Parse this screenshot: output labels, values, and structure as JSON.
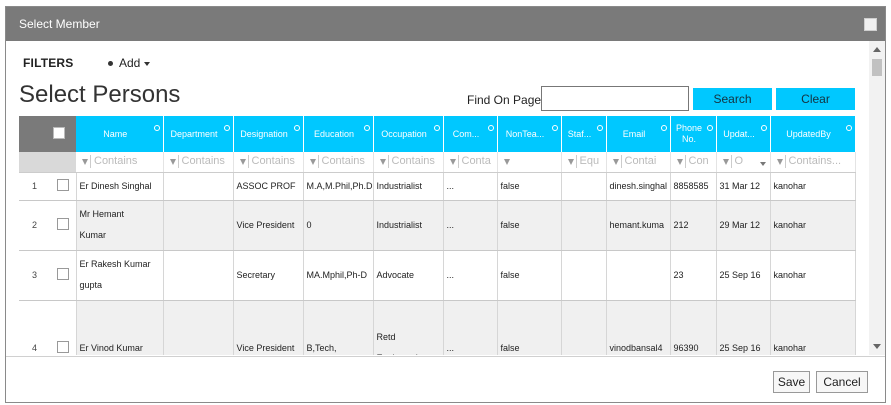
{
  "dialog": {
    "title": "Select Member"
  },
  "toolbar": {
    "filters_label": "FILTERS",
    "add_label": "Add"
  },
  "page": {
    "title": "Select Persons"
  },
  "find": {
    "label": "Find On Page",
    "value": "",
    "search_label": "Search",
    "clear_label": "Clear"
  },
  "grid": {
    "columns": [
      {
        "label": "Name"
      },
      {
        "label": "Department"
      },
      {
        "label": "Designation"
      },
      {
        "label": "Education"
      },
      {
        "label": "Occupation"
      },
      {
        "label": "Com..."
      },
      {
        "label": "NonTea..."
      },
      {
        "label": "Staf..."
      },
      {
        "label": "Email"
      },
      {
        "label": "Phone No."
      },
      {
        "label": "Updat..."
      },
      {
        "label": "UpdatedBy"
      }
    ],
    "filters": [
      "Contains",
      "Contains",
      "Contains",
      "Contains",
      "Contains",
      "Conta",
      "",
      "Equ",
      "Contai",
      "Con",
      "O",
      "Contains..."
    ],
    "rows": [
      {
        "num": "1",
        "name": "Er Dinesh Singhal",
        "department": "",
        "designation": "ASSOC PROF",
        "education": "M.A,M.Phil,Ph.D",
        "occupation": "Industrialist",
        "com": "...",
        "nonteaching": "false",
        "staff": "",
        "email": "dinesh.singhal",
        "phone": "8858585",
        "updated": "31 Mar 12",
        "updatedby": "kanohar"
      },
      {
        "num": "2",
        "name": "Mr Hemant Kumar",
        "department": "",
        "designation": "Vice President",
        "education": "0",
        "occupation": "Industrialist",
        "com": "...",
        "nonteaching": "false",
        "staff": "",
        "email": "hemant.kuma",
        "phone": "212",
        "updated": "29 Mar 12",
        "updatedby": "kanohar"
      },
      {
        "num": "3",
        "name": "Er Rakesh Kumar gupta",
        "department": "",
        "designation": "Secretary",
        "education": "MA.Mphil,Ph-D",
        "occupation": "Advocate",
        "com": "...",
        "nonteaching": "false",
        "staff": "",
        "email": "",
        "phone": "23",
        "updated": "25 Sep 16",
        "updatedby": "kanohar"
      },
      {
        "num": "4",
        "name": "Er Vinod Kumar",
        "department": "",
        "designation": "Vice President",
        "education": "B,Tech,",
        "occupation": "Retd Engineer-In-",
        "com": "...",
        "nonteaching": "false",
        "staff": "",
        "email": "vinodbansal4",
        "phone": "96390",
        "updated": "25 Sep 16",
        "updatedby": "kanohar"
      }
    ]
  },
  "footer": {
    "save_label": "Save",
    "cancel_label": "Cancel"
  }
}
